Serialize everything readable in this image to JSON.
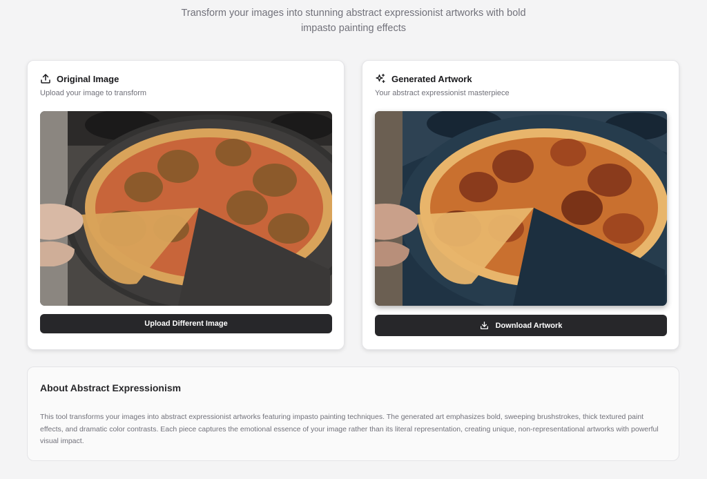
{
  "header": {
    "subtitle_line1": "Transform your images into stunning abstract expressionist artworks with bold",
    "subtitle_line2": "impasto painting effects"
  },
  "original": {
    "title": "Original Image",
    "description": "Upload your image to transform",
    "icon": "upload-icon",
    "button_label": "Upload Different Image"
  },
  "generated": {
    "title": "Generated Artwork",
    "description": "Your abstract expressionist masterpiece",
    "icon": "sparkles-icon",
    "button_label": "Download Artwork",
    "button_icon": "download-icon"
  },
  "about": {
    "title": "About Abstract Expressionism",
    "body": "This tool transforms your images into abstract expressionist artworks featuring impasto painting techniques. The generated art emphasizes bold, sweeping brushstrokes, thick textured paint effects, and dramatic color contrasts. Each piece captures the emotional essence of your image rather than its literal representation, creating unique, non-representational artworks with powerful visual impact."
  },
  "colors": {
    "background": "#f4f4f5",
    "card": "#ffffff",
    "button": "#27272a",
    "muted_text": "#71717a"
  }
}
